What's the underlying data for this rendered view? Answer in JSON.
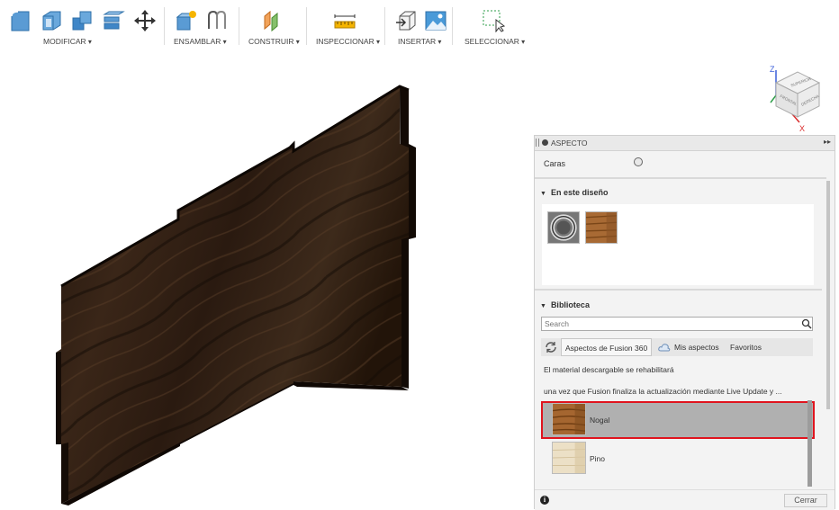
{
  "toolbar": {
    "groups": [
      {
        "label": "MODIFICAR"
      },
      {
        "label": "ENSAMBLAR"
      },
      {
        "label": "CONSTRUIR"
      },
      {
        "label": "INSPECCIONAR"
      },
      {
        "label": "INSERTAR"
      },
      {
        "label": "SELECCIONAR"
      }
    ]
  },
  "viewcube": {
    "axis_z": "Z",
    "axis_x": "X",
    "face_top": "SUPERIOR",
    "face_front": "FRONTAL",
    "face_right": "DERECHA"
  },
  "panel": {
    "title": "ASPECTO",
    "caras_label": "Caras",
    "design_section": "En este diseño",
    "library_section": "Biblioteca",
    "search_placeholder": "Search",
    "tabs": [
      {
        "label": "Aspectos de Fusion 360"
      },
      {
        "label": "Mis aspectos"
      },
      {
        "label": "Favoritos"
      }
    ],
    "message_line1": "El material descargable se rehabilitará",
    "message_line2": "una vez que Fusion finaliza la actualización mediante Live Update y ...",
    "materials": [
      {
        "name": "Nogal",
        "selected": true
      },
      {
        "name": "Pino",
        "selected": false
      }
    ],
    "close_label": "Cerrar"
  },
  "colors": {
    "highlight": "#e0141e",
    "walnut": "#2a1a12",
    "selection": "#b0b0b0"
  }
}
